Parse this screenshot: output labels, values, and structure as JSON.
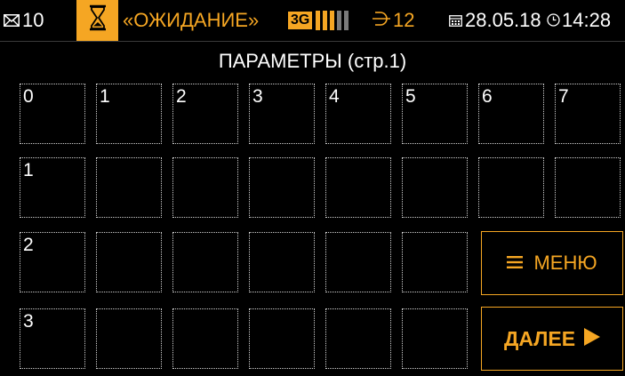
{
  "status_bar": {
    "messages_count": "10",
    "status_text": "«ОЖИДАНИЕ»",
    "network_type": "3G",
    "signal_level": 0.6,
    "antenna_count": "12",
    "date": "28.05.18",
    "time": "14:28",
    "icons": {
      "mail": "mail-icon",
      "hourglass": "hourglass-icon",
      "antenna": "antenna-icon",
      "calendar": "calendar-icon",
      "clock": "clock-icon"
    }
  },
  "title": "ПАРАМЕТРЫ (стр.1)",
  "grid": {
    "row_labels": [
      "0",
      "1",
      "2",
      "3"
    ],
    "column_labels": [
      "1",
      "2",
      "3",
      "4",
      "5",
      "6",
      "7"
    ]
  },
  "buttons": {
    "menu_label": "МЕНЮ",
    "next_label": "ДАЛЕЕ"
  },
  "colors": {
    "accent": "#f5a623",
    "background": "#000000",
    "text": "#ffffff",
    "cell_border": "#cfcfcf",
    "signal_inactive": "#7a7a7a"
  }
}
